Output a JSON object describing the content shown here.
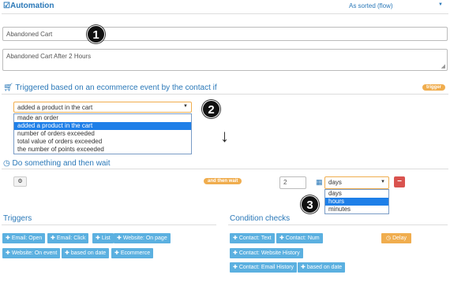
{
  "header": {
    "title": "Automation",
    "sort_label": "As sorted (flow)"
  },
  "name_input": {
    "value": "Abandoned Cart"
  },
  "description_input": {
    "value": "Abandoned Cart After 2 Hours"
  },
  "trigger_section": {
    "title": "Triggered based on an ecommerce event by the contact if",
    "badge": "trigger",
    "select_value": "added a product in the cart",
    "options": [
      "made an order",
      "added a product in the cart",
      "number of orders exceeded",
      "total value of orders exceeded",
      "the number of points exceeded"
    ],
    "selected_index": 1
  },
  "action_section": {
    "title": "Do something and then wait",
    "badge": "and then wait",
    "wait_amount": "2",
    "unit_value": "days",
    "unit_options": [
      "days",
      "hours",
      "minutes"
    ],
    "unit_selected_index": 1
  },
  "callouts": [
    "1",
    "2",
    "3"
  ],
  "triggers": {
    "title": "Triggers",
    "buttons": [
      "Email: Open",
      "Email: Click",
      "List",
      "Website: On page",
      "Website: On event",
      "based on date",
      "Ecommerce"
    ]
  },
  "conditions": {
    "title": "Condition checks",
    "buttons": [
      "Contact: Text",
      "Contact: Num",
      "Contact: Website History",
      "Contact: Email History",
      "based on date"
    ],
    "delay_label": "Delay"
  },
  "colors": {
    "accent": "#2a78b8",
    "orange": "#f0ad4e",
    "button_blue": "#5bb0e0",
    "danger": "#d9534f",
    "selected": "#1e7fe8"
  },
  "icons": [
    "checkbox-icon",
    "cart-icon",
    "clock-icon",
    "gear-icon",
    "calendar-icon",
    "arrow-down-icon",
    "plus-icon",
    "minus-icon"
  ]
}
